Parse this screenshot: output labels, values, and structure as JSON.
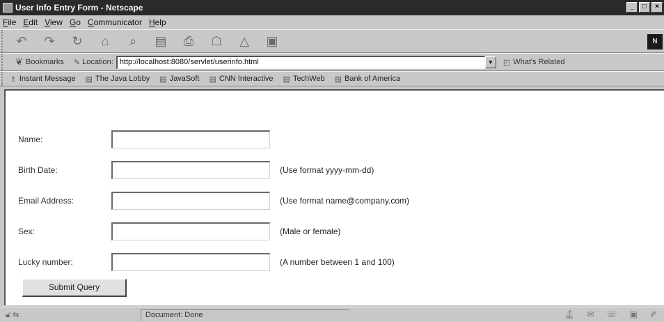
{
  "window": {
    "title": "User Info Entry Form - Netscape"
  },
  "menu": [
    {
      "label": "File"
    },
    {
      "label": "Edit"
    },
    {
      "label": "View"
    },
    {
      "label": "Go"
    },
    {
      "label": "Communicator"
    },
    {
      "label": "Help"
    }
  ],
  "nav": {
    "buttons": [
      {
        "name": "back-button",
        "icon": "back-arrow-icon",
        "glyph": "↶"
      },
      {
        "name": "forward-button",
        "icon": "forward-arrow-icon",
        "glyph": "↷"
      },
      {
        "name": "reload-button",
        "icon": "reload-icon",
        "glyph": "↻"
      },
      {
        "name": "home-button",
        "icon": "home-icon",
        "glyph": "⌂"
      },
      {
        "name": "search-button",
        "icon": "search-icon",
        "glyph": "⌕"
      },
      {
        "name": "guide-button",
        "icon": "guide-icon",
        "glyph": "▤"
      },
      {
        "name": "print-button",
        "icon": "print-icon",
        "glyph": "⎙"
      },
      {
        "name": "security-button",
        "icon": "security-icon",
        "glyph": "☖"
      },
      {
        "name": "shop-button",
        "icon": "shop-icon",
        "glyph": "△"
      },
      {
        "name": "stop-button",
        "icon": "stop-icon",
        "glyph": "▣"
      }
    ],
    "logo_label": "N"
  },
  "location": {
    "bookmarks_label": "Bookmarks",
    "location_label": "Location:",
    "url": "http://localhost:8080/servlet/userinfo.html",
    "whats_related_label": "What's Related"
  },
  "personal_toolbar": [
    {
      "label": "Instant Message"
    },
    {
      "label": "The Java Lobby"
    },
    {
      "label": "JavaSoft"
    },
    {
      "label": "CNN Interactive"
    },
    {
      "label": "TechWeb"
    },
    {
      "label": "Bank of America"
    }
  ],
  "form": {
    "fields": [
      {
        "label": "Name:",
        "value": "",
        "hint": ""
      },
      {
        "label": "Birth Date:",
        "value": "",
        "hint": "(Use format yyyy-mm-dd)"
      },
      {
        "label": "Email Address:",
        "value": "",
        "hint": "(Use format name@company.com)"
      },
      {
        "label": "Sex:",
        "value": "",
        "hint": "(Male or female)"
      },
      {
        "label": "Lucky number:",
        "value": "",
        "hint": "(A number between 1 and 100)"
      }
    ],
    "submit_label": "Submit Query"
  },
  "status": {
    "text": "Document: Done"
  }
}
